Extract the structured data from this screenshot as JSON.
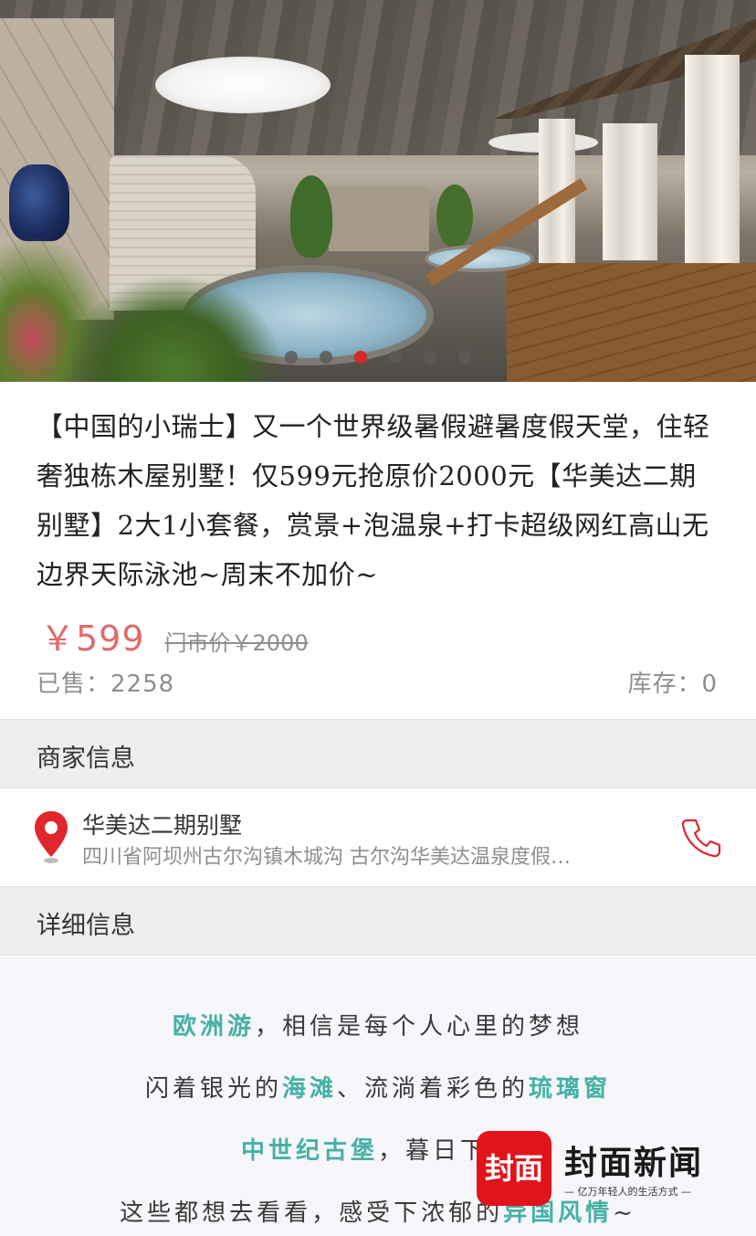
{
  "hero": {
    "carousel_count": 6,
    "carousel_active_index": 2,
    "active_dot_color": "#d42b26"
  },
  "product": {
    "title": "【中国的小瑞士】又一个世界级暑假避暑度假天堂，住轻奢独栋木屋别墅！仅599元抢原价2000元【华美达二期别墅】2大1小套餐，赏景+泡温泉+打卡超级网红高山无边界天际泳池~周末不加价~",
    "price": "￥599",
    "market_price": "门市价￥2000",
    "sold": "已售：2258",
    "stock": "库存：0",
    "price_color": "#e06a6a"
  },
  "merchant_section": {
    "title": "商家信息"
  },
  "merchant": {
    "name": "华美达二期别墅",
    "address": "四川省阿坝州古尔沟镇木城沟 古尔沟华美达温泉度假…",
    "location_icon": "map-pin-icon",
    "phone_icon": "phone-icon"
  },
  "detail_section": {
    "title": "详细信息"
  },
  "detail": {
    "line1": {
      "hl1": "欧洲游",
      "text1": "，相信是每个人心里的梦想"
    },
    "line2": {
      "text1": "闪着银光的",
      "hl1": "海滩",
      "text2": "、流淌着彩色的",
      "hl2": "琉璃窗"
    },
    "line3": {
      "hl1": "中世纪古堡",
      "text1": "，暮日下的"
    },
    "line4": {
      "text1": "这些都想去看看，感受下浓郁的",
      "hl1": "异国风情",
      "text2": "~"
    },
    "highlight_color": "#45b1a6"
  },
  "watermark": {
    "logo_text": "封面",
    "brand": "封面新闻",
    "slogan": "— 亿万年轻人的生活方式 —"
  }
}
